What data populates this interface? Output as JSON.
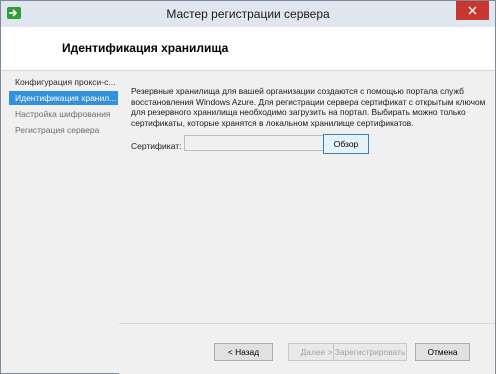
{
  "window": {
    "title": "Мастер регистрации сервера"
  },
  "header": {
    "title": "Идентификация хранилища"
  },
  "sidebar": {
    "items": [
      {
        "label": "Конфигурация прокси-с..."
      },
      {
        "label": "Идентификация хранил..."
      },
      {
        "label": "Настройка шифрования"
      },
      {
        "label": "Регистрация сервера"
      }
    ]
  },
  "content": {
    "description": "Резервные хранилища для вашей организации создаются с помощью портала служб восстановления Windows Azure. Для регистрации сервера сертификат с открытым ключом для резервного хранилища необходимо загрузить на портал. Выбирать можно только сертификаты, которые хранятся в локальном хранилище сертификатов.",
    "certificate_label": "Сертификат:",
    "certificate_value": "",
    "browse_label": "Обзор"
  },
  "footer": {
    "back_label": "< Назад",
    "next_label": "Далее >",
    "register_label": "Зарегистрировать",
    "cancel_label": "Отмена"
  },
  "colors": {
    "active_step": "#3390dd",
    "close_button": "#c7372f",
    "app_icon": "#2e9e3a"
  }
}
